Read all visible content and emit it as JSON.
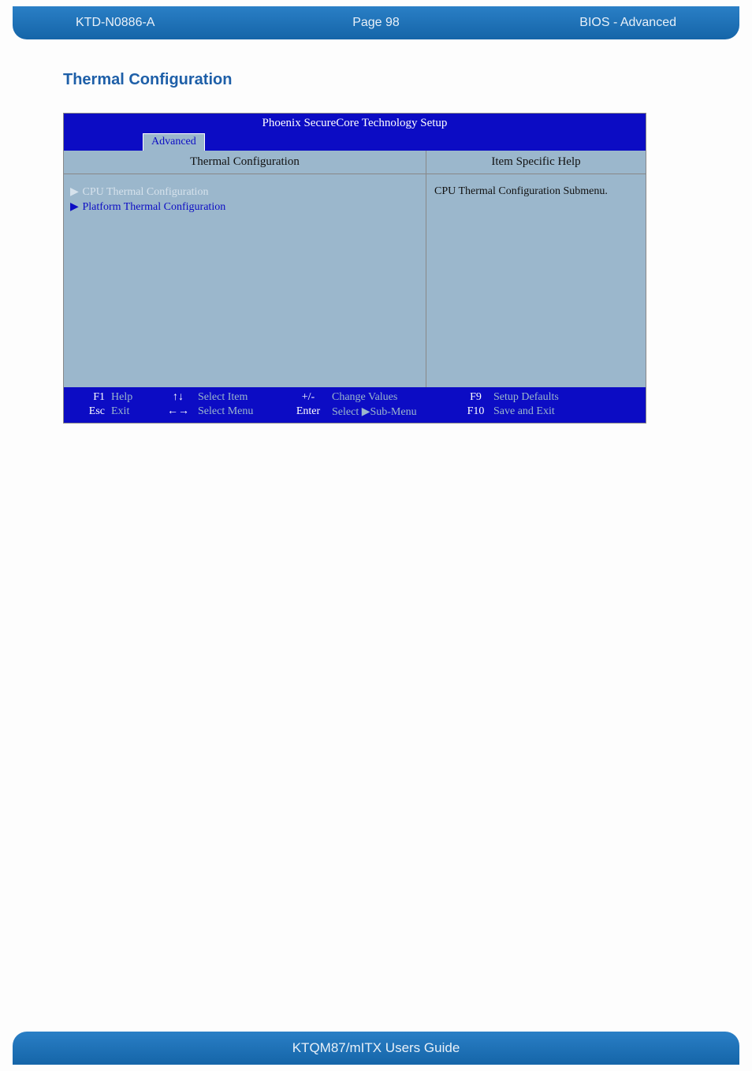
{
  "header": {
    "doc_id": "KTD-N0886-A",
    "page_label": "Page 98",
    "section": "BIOS  - Advanced"
  },
  "section_title": "Thermal Configuration",
  "bios": {
    "title": "Phoenix SecureCore Technology Setup",
    "active_tab": "Advanced",
    "left_header": "Thermal Configuration",
    "right_header": "Item Specific Help",
    "menu_items": [
      {
        "label": "CPU Thermal Configuration",
        "selected": true
      },
      {
        "label": "Platform Thermal Configuration",
        "selected": false
      }
    ],
    "help_text": "CPU Thermal Configuration Submenu.",
    "footer": {
      "row1": {
        "k1": "F1",
        "l1": "Help",
        "k2": "↑↓",
        "l2": "Select Item",
        "k3": "+/-",
        "l3": "Change Values",
        "k4": "F9",
        "l4": "Setup Defaults"
      },
      "row2": {
        "k1": "Esc",
        "l1": "Exit",
        "k2": "←→",
        "l2": "Select Menu",
        "k3": "Enter",
        "l3": "Select ▶Sub-Menu",
        "k4": "F10",
        "l4": "Save and Exit"
      }
    }
  },
  "footer_text": "KTQM87/mITX Users Guide"
}
